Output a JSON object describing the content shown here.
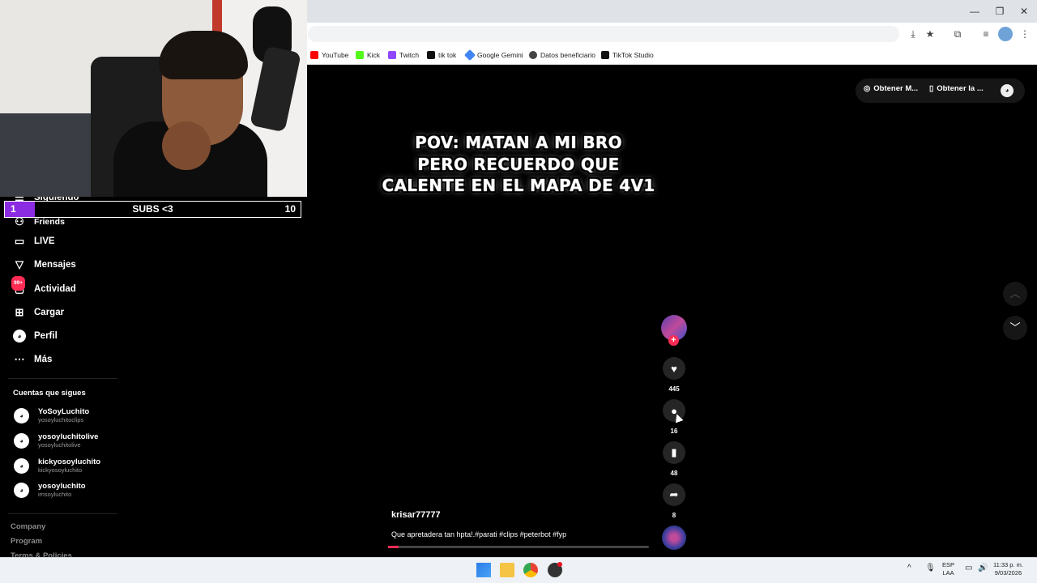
{
  "browser": {
    "window_controls": {
      "minimize": "—",
      "restore": "❐",
      "close": "✕"
    },
    "bookmarks": [
      {
        "label": "YouTube",
        "color": "#ff0000"
      },
      {
        "label": "Kick",
        "color": "#53fc18"
      },
      {
        "label": "Twitch",
        "color": "#9146ff"
      },
      {
        "label": "tik tok",
        "color": "#111111"
      },
      {
        "label": "Google Gemini",
        "color": "#4285f4"
      },
      {
        "label": "Datos beneficiario",
        "color": "#444444"
      },
      {
        "label": "TikTok Studio",
        "color": "#111111"
      }
    ]
  },
  "sidebar": {
    "partial_items": [
      "Siguiendo",
      "Friends"
    ],
    "items": [
      {
        "label": "LIVE",
        "icon": "live-icon"
      },
      {
        "label": "Mensajes",
        "icon": "messages-icon"
      },
      {
        "label": "Actividad",
        "icon": "activity-icon",
        "badge": "99+"
      },
      {
        "label": "Cargar",
        "icon": "upload-icon"
      },
      {
        "label": "Perfil",
        "icon": "profile-icon"
      },
      {
        "label": "Más",
        "icon": "more-icon"
      }
    ],
    "following_title": "Cuentas que sigues",
    "following": [
      {
        "name": "YoSoyLuchito",
        "handle": "yosoyluchitoclips"
      },
      {
        "name": "yosoyluchitolive",
        "handle": "yosoyluchitolive"
      },
      {
        "name": "kickyosoyluchito",
        "handle": "kickyosoyluchito"
      },
      {
        "name": "yosoyluchito",
        "handle": "imsoyluchito"
      }
    ],
    "footer_links": [
      "Company",
      "Program",
      "Terms & Policies"
    ]
  },
  "subs_goal": {
    "current": "1",
    "label": "SUBS <3",
    "goal": "10",
    "fill_fraction": 0.1,
    "fill_color": "#8b2be2"
  },
  "top_actions": {
    "get_coins": "Obtener M...",
    "get_app": "Obtener la ..."
  },
  "video": {
    "overlay_lines": [
      "POV: MATAN A MI BRO",
      "PERO RECUERDO QUE",
      "CALENTE EN EL MAPA DE 4V1"
    ],
    "author": "krisar77777",
    "caption": "Que apretadera tan hpta!.#parati #clips #peterbot #fyp",
    "likes": "445",
    "comments": "16",
    "saves": "48",
    "shares": "8",
    "progress_fraction": 0.04
  },
  "taskbar": {
    "language": "ESP",
    "layout": "LAA",
    "time": "11:33 p. m.",
    "date": "9/03/2026"
  }
}
